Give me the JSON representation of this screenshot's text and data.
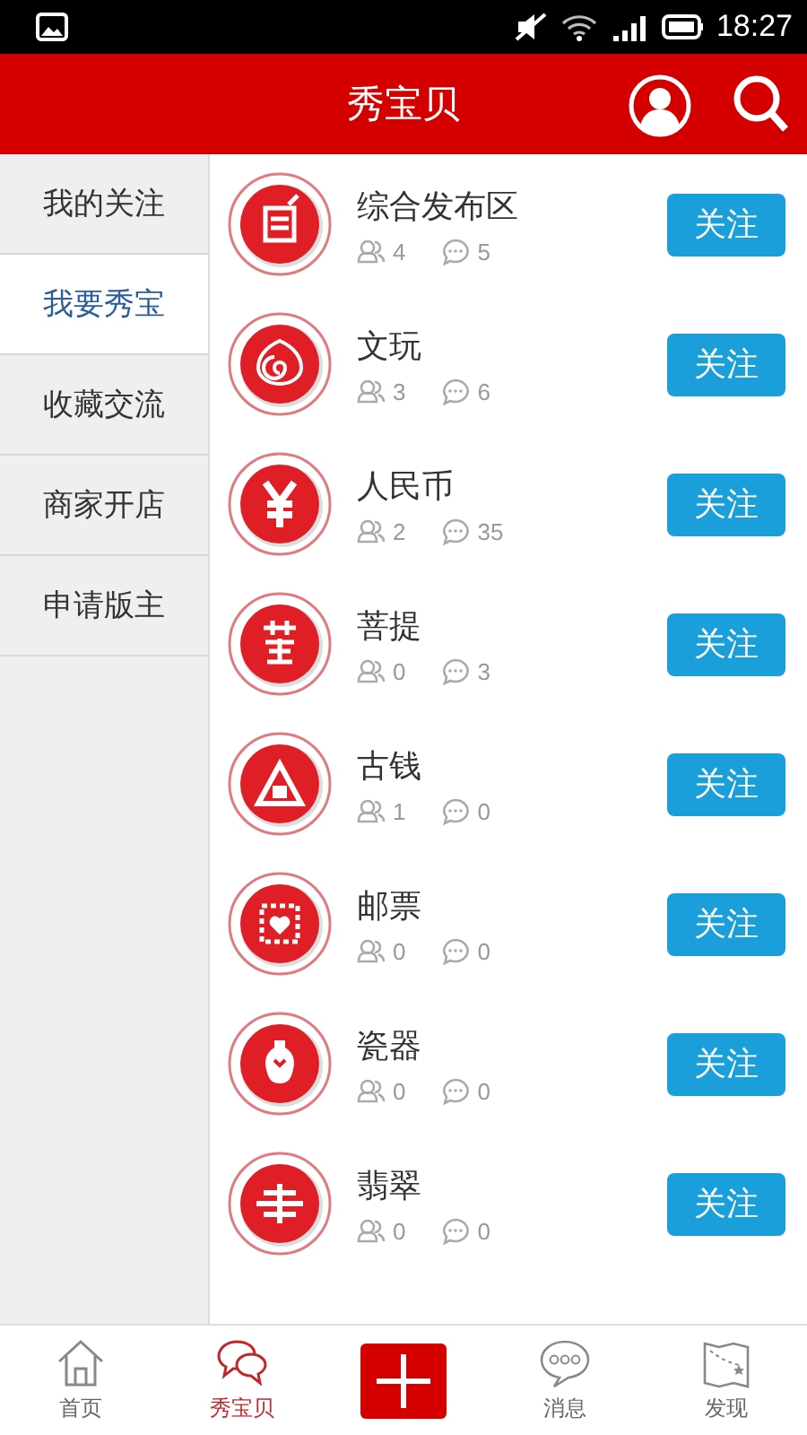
{
  "status_bar": {
    "time": "18:27"
  },
  "header": {
    "title": "秀宝贝"
  },
  "sidebar": {
    "items": [
      {
        "label": "我的关注",
        "selected": false
      },
      {
        "label": "我要秀宝",
        "selected": true
      },
      {
        "label": "收藏交流",
        "selected": false
      },
      {
        "label": "商家开店",
        "selected": false
      },
      {
        "label": "申请版主",
        "selected": false
      }
    ]
  },
  "boards": [
    {
      "name": "综合发布区",
      "members": "4",
      "posts": "5",
      "button": "关注"
    },
    {
      "name": "文玩",
      "members": "3",
      "posts": "6",
      "button": "关注"
    },
    {
      "name": "人民币",
      "members": "2",
      "posts": "35",
      "button": "关注"
    },
    {
      "name": "菩提",
      "members": "0",
      "posts": "3",
      "button": "关注"
    },
    {
      "name": "古钱",
      "members": "1",
      "posts": "0",
      "button": "关注"
    },
    {
      "name": "邮票",
      "members": "0",
      "posts": "0",
      "button": "关注"
    },
    {
      "name": "瓷器",
      "members": "0",
      "posts": "0",
      "button": "关注"
    },
    {
      "name": "翡翠",
      "members": "0",
      "posts": "0",
      "button": "关注"
    }
  ],
  "bottom_nav": [
    {
      "kind": "tab",
      "label": "首页",
      "selected": false
    },
    {
      "kind": "tab",
      "label": "秀宝贝",
      "selected": true
    },
    {
      "kind": "add",
      "selected": false
    },
    {
      "kind": "tab",
      "label": "消息",
      "selected": false
    },
    {
      "kind": "tab",
      "label": "发现",
      "selected": false
    }
  ]
}
